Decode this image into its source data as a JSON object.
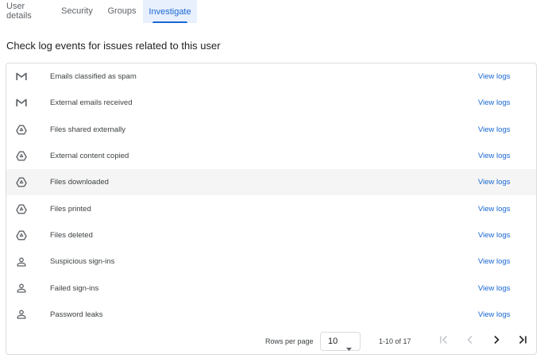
{
  "tabs": [
    {
      "label": "User details",
      "active": false
    },
    {
      "label": "Security",
      "active": false
    },
    {
      "label": "Groups",
      "active": false
    },
    {
      "label": "Investigate",
      "active": true
    }
  ],
  "heading": "Check log events for issues related to this user",
  "rows": [
    {
      "icon": "gmail-icon",
      "label": "Emails classified as spam",
      "link": "View logs"
    },
    {
      "icon": "gmail-icon",
      "label": "External emails received",
      "link": "View logs"
    },
    {
      "icon": "drive-icon",
      "label": "Files shared externally",
      "link": "View logs"
    },
    {
      "icon": "drive-icon",
      "label": "External content copied",
      "link": "View logs"
    },
    {
      "icon": "drive-icon",
      "label": "Files downloaded",
      "link": "View logs"
    },
    {
      "icon": "drive-icon",
      "label": "Files printed",
      "link": "View logs"
    },
    {
      "icon": "drive-icon",
      "label": "Files deleted",
      "link": "View logs"
    },
    {
      "icon": "person-icon",
      "label": "Suspicious sign-ins",
      "link": "View logs"
    },
    {
      "icon": "person-icon",
      "label": "Failed sign-ins",
      "link": "View logs"
    },
    {
      "icon": "person-icon",
      "label": "Password leaks",
      "link": "View logs"
    }
  ],
  "footer": {
    "rows_per_page_label": "Rows per page",
    "rows_per_page_value": "10",
    "range": "1-10 of 17"
  },
  "colors": {
    "accent": "#1967d2",
    "active_tab_bg": "#e8f0fe",
    "row_hover": "#f5f5f5",
    "disabled": "#bdc1c6"
  }
}
